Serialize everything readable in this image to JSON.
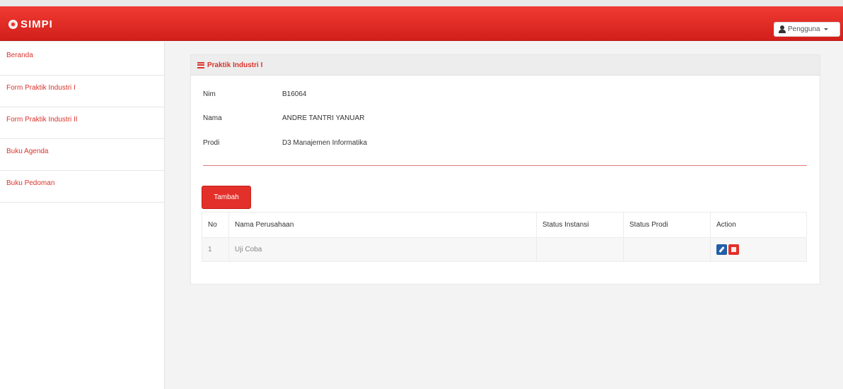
{
  "app": {
    "brand": "SIMPI"
  },
  "navbar": {
    "user_label": "Pengguna"
  },
  "sidebar": {
    "items": [
      {
        "label": "Beranda"
      },
      {
        "label": "Form Praktik Industri I"
      },
      {
        "label": "Form Praktik Industri II"
      },
      {
        "label": "Buku Agenda"
      },
      {
        "label": "Buku Pedoman"
      }
    ]
  },
  "panel": {
    "title": "Praktik Industri I",
    "info": [
      {
        "label": "Nim",
        "value": "B16064"
      },
      {
        "label": "Nama",
        "value": "ANDRE TANTRI YANUAR"
      },
      {
        "label": "Prodi",
        "value": "D3 Manajemen Informatika"
      }
    ],
    "add_button": "Tambah",
    "table": {
      "headers": [
        "No",
        "Nama Perusahaan",
        "Status Instansi",
        "Status Prodi",
        "Action"
      ],
      "rows": [
        {
          "no": "1",
          "company": "Uji Coba",
          "status_instansi": "",
          "status_prodi": ""
        }
      ]
    }
  },
  "colors": {
    "primary": "#e3302a",
    "edit": "#1f5fa8"
  }
}
